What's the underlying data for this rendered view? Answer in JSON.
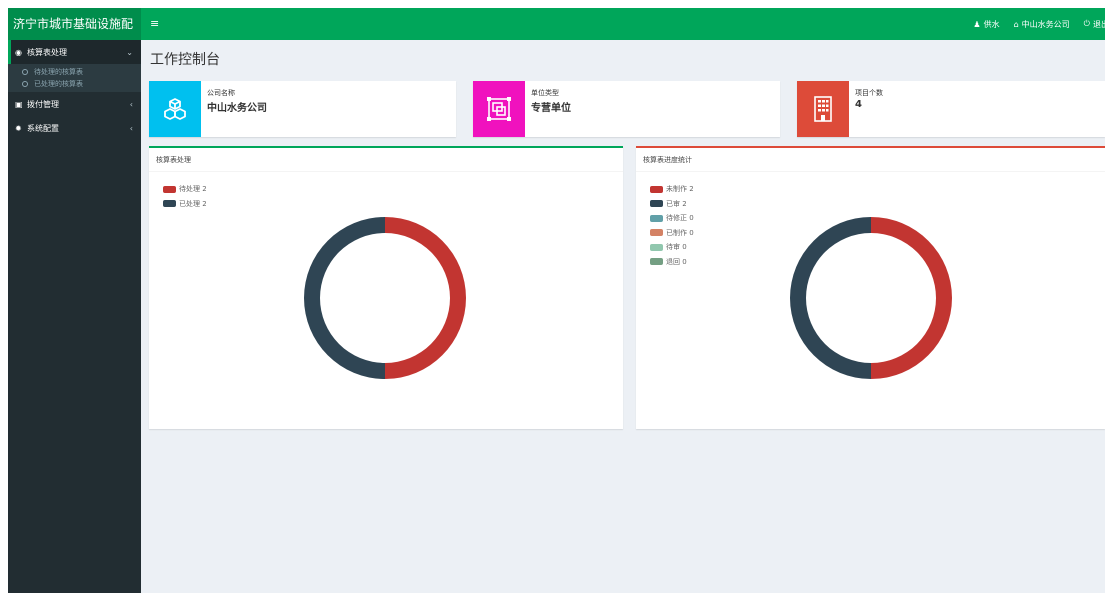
{
  "header": {
    "app_title": "济宁市城市基础设施配",
    "menu_toggle_glyph": "≡",
    "user_icon_glyph": "♟",
    "user_label": "供水",
    "home_icon_glyph": "⌂",
    "company_label": "中山水务公司",
    "logout_icon_glyph": "⏻",
    "logout_label": "退出",
    "brand_color": "#00a65a"
  },
  "sidebar": {
    "items": [
      {
        "icon": "dashboard-icon",
        "icon_glyph": "◉",
        "label": "核算表处理",
        "caret": "⌄",
        "active": true,
        "children": [
          {
            "label": "待处理的核算表"
          },
          {
            "label": "已处理的核算表"
          }
        ]
      },
      {
        "icon": "money-icon",
        "icon_glyph": "▣",
        "label": "拨付管理",
        "caret": "‹"
      },
      {
        "icon": "gear-icon",
        "icon_glyph": "✹",
        "label": "系统配置",
        "caret": "‹"
      }
    ]
  },
  "page": {
    "title": "工作控制台"
  },
  "info_boxes": [
    {
      "label": "公司名称",
      "value": "中山水务公司",
      "icon": "cubes-icon",
      "color": "#00c0ef"
    },
    {
      "label": "单位类型",
      "value": "专营单位",
      "icon": "object-group-icon",
      "color": "#f012be"
    },
    {
      "label": "项目个数",
      "value": "4",
      "icon": "building-icon",
      "color": "#dd4b39"
    }
  ],
  "panels": [
    {
      "title": "核算表处理",
      "accent": "#00a65a",
      "chart_data": {
        "type": "pie",
        "categories": [
          "待处理",
          "已处理"
        ],
        "values": [
          2,
          2
        ],
        "legend": [
          "待处理 2",
          "已处理 2"
        ],
        "colors": [
          "#c23531",
          "#2f4554"
        ],
        "legend_position": "top-left",
        "style": "donut"
      }
    },
    {
      "title": "核算表进度统计",
      "accent": "#dd4b39",
      "chart_data": {
        "type": "pie",
        "categories": [
          "未制作",
          "已审",
          "待修正",
          "已制作",
          "待审",
          "退回"
        ],
        "values": [
          2,
          2,
          0,
          0,
          0,
          0
        ],
        "legend": [
          "未制作 2",
          "已审 2",
          "待修正 0",
          "已制作 0",
          "待审 0",
          "退回 0"
        ],
        "colors": [
          "#c23531",
          "#2f4554",
          "#61a0a8",
          "#d48265",
          "#91c7ae",
          "#749f83"
        ],
        "legend_position": "top-left",
        "style": "donut"
      }
    }
  ]
}
